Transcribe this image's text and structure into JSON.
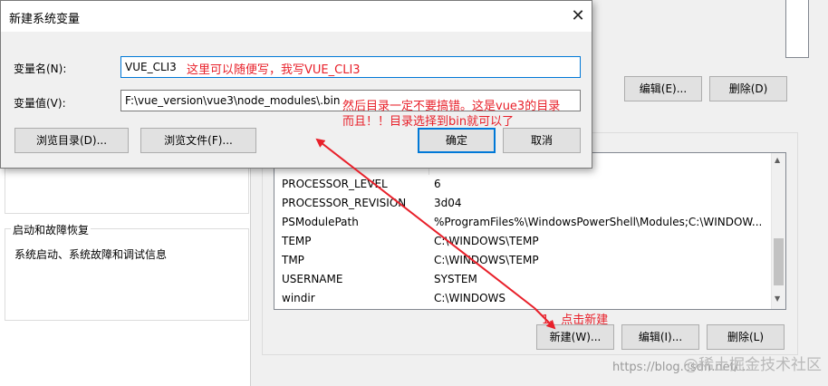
{
  "dialog": {
    "title": "新建系统变量",
    "close_glyph": "✕",
    "name_label": "变量名(N):",
    "name_value": "VUE_CLI3",
    "value_label": "变量值(V):",
    "value_value": "F:\\vue_version\\vue3\\node_modules\\.bin",
    "browse_dir": "浏览目录(D)...",
    "browse_file": "浏览文件(F)...",
    "ok": "确定",
    "cancel": "取消"
  },
  "background": {
    "startup_group_title": "启动和故障恢复",
    "startup_desc": "系统启动、系统故障和调试信息",
    "user_vars": {
      "edit": "编辑(E)...",
      "delete": "删除(D)"
    },
    "system_vars": {
      "rows": [
        {
          "name": "PROCESSOR_LEVEL",
          "value": "6"
        },
        {
          "name": "PROCESSOR_REVISION",
          "value": "3d04"
        },
        {
          "name": "PSModulePath",
          "value": "%ProgramFiles%\\WindowsPowerShell\\Modules;C:\\WINDOW..."
        },
        {
          "name": "TEMP",
          "value": "C:\\WINDOWS\\TEMP"
        },
        {
          "name": "TMP",
          "value": "C:\\WINDOWS\\TEMP"
        },
        {
          "name": "USERNAME",
          "value": "SYSTEM"
        },
        {
          "name": "windir",
          "value": "C:\\WINDOWS"
        }
      ],
      "new": "新建(W)...",
      "edit": "编辑(I)...",
      "delete": "删除(L)"
    }
  },
  "annotations": {
    "name_note": "这里可以随便写，我写VUE_CLI3",
    "value_note_line1": "然后目录一定不要搞错。这是vue3的目录",
    "value_note_line2": "而且！！目录选择到bin就可以了",
    "step_note": "1、点击新建",
    "color": "#e8202a"
  },
  "watermark": {
    "url": "https://blog.csdn.net/...",
    "site": "@稀土掘金技术社区"
  }
}
